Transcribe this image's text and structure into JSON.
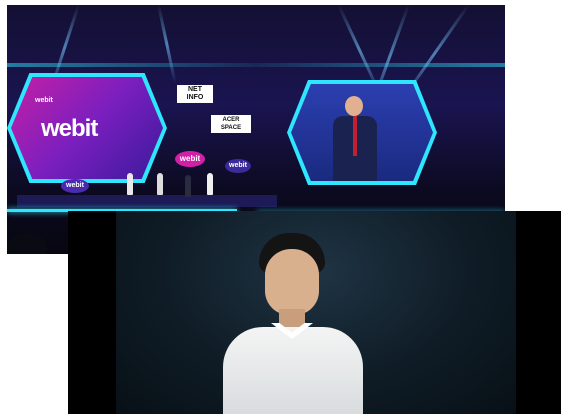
{
  "stage_photo": {
    "left_screen_logo": "webit",
    "left_screen_small_logo": "webit",
    "center_logo": "webit",
    "side_logo": "webit",
    "podium_logo": "webit",
    "sign_top": "NET\nINFO",
    "sign_bottom": "ACER SPACE"
  },
  "colors": {
    "neon_cyan": "#2fe6ff",
    "magenta": "#d21fa8",
    "stage_blue": "#1a1450"
  }
}
